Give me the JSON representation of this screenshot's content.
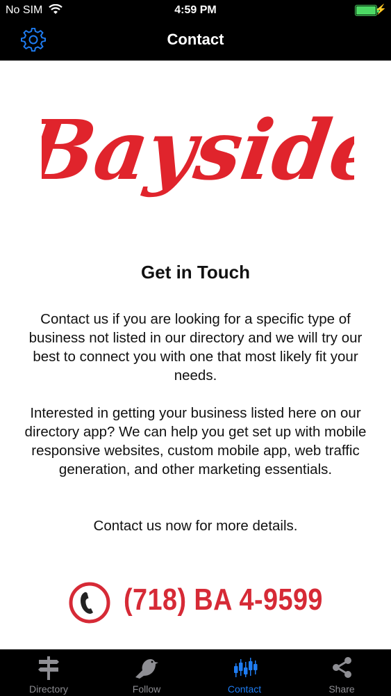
{
  "status_bar": {
    "carrier": "No SIM",
    "time": "4:59 PM"
  },
  "nav": {
    "title": "Contact",
    "settings_icon": "gear-icon"
  },
  "logo": {
    "text": "Bayside",
    "color": "#e0242c"
  },
  "content": {
    "heading": "Get in Touch",
    "paragraph1": "Contact us if you are looking for a specific type of business not listed in our directory and we will try our best to connect you with one that most likely fit your needs.",
    "paragraph2": "Interested in getting your business listed here on our directory app? We can help you get set up with mobile responsive websites, custom mobile app, web traffic generation, and other marketing essentials.",
    "paragraph3": "Contact us now for more details.",
    "phone": "(718) BA 4-9599"
  },
  "tabs": [
    {
      "label": "Directory",
      "icon": "signpost-icon",
      "active": false
    },
    {
      "label": "Follow",
      "icon": "bird-icon",
      "active": false
    },
    {
      "label": "Contact",
      "icon": "chart-icon",
      "active": true
    },
    {
      "label": "Share",
      "icon": "share-icon",
      "active": false
    }
  ],
  "colors": {
    "accent": "#1e7cf2",
    "brand_red": "#d62a36",
    "bar_bg": "#000000"
  }
}
